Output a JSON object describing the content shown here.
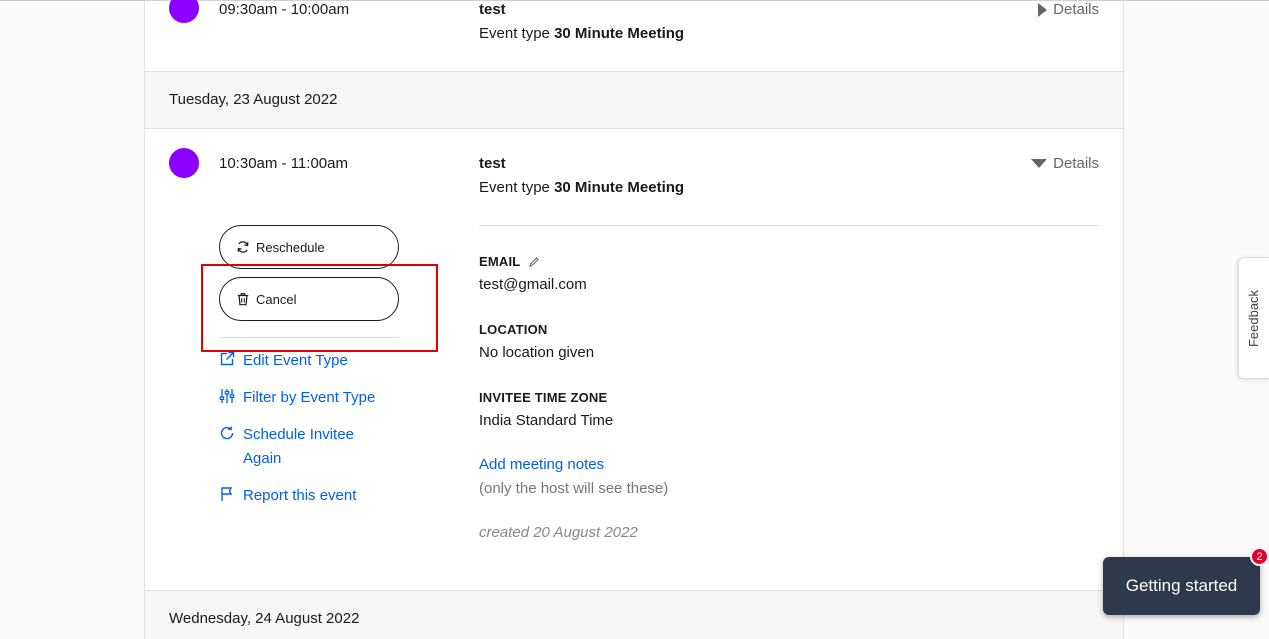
{
  "events": [
    {
      "time": "09:30am - 10:00am",
      "name": "test",
      "event_type_prefix": "Event type",
      "event_type": "30 Minute Meeting",
      "details_label": "Details"
    },
    {
      "time": "10:30am - 11:00am",
      "name": "test",
      "event_type_prefix": "Event type",
      "event_type": "30 Minute Meeting",
      "details_label": "Details"
    }
  ],
  "dates": {
    "tuesday": "Tuesday, 23 August 2022",
    "wednesday": "Wednesday, 24 August 2022"
  },
  "actions": {
    "reschedule": "Reschedule",
    "cancel": "Cancel",
    "edit_event_type": "Edit Event Type",
    "filter_by_event_type": "Filter by Event Type",
    "schedule_invitee_line1": "Schedule Invitee",
    "schedule_invitee_line2": "Again",
    "report_event": "Report this event"
  },
  "info": {
    "email_label": "EMAIL",
    "email_value": "test@gmail.com",
    "location_label": "LOCATION",
    "location_value": "No location given",
    "timezone_label": "INVITEE TIME ZONE",
    "timezone_value": "India Standard Time",
    "add_notes": "Add meeting notes",
    "notes_hint": "(only the host will see these)",
    "created": "created 20 August 2022"
  },
  "widgets": {
    "feedback": "Feedback",
    "getting_started": "Getting started",
    "badge_count": "2"
  },
  "colors": {
    "event_dot": "#8c00ff",
    "link": "#0060e6",
    "highlight": "#e00000",
    "getting_started_bg": "#2e3a4a",
    "badge": "#e0002a"
  }
}
